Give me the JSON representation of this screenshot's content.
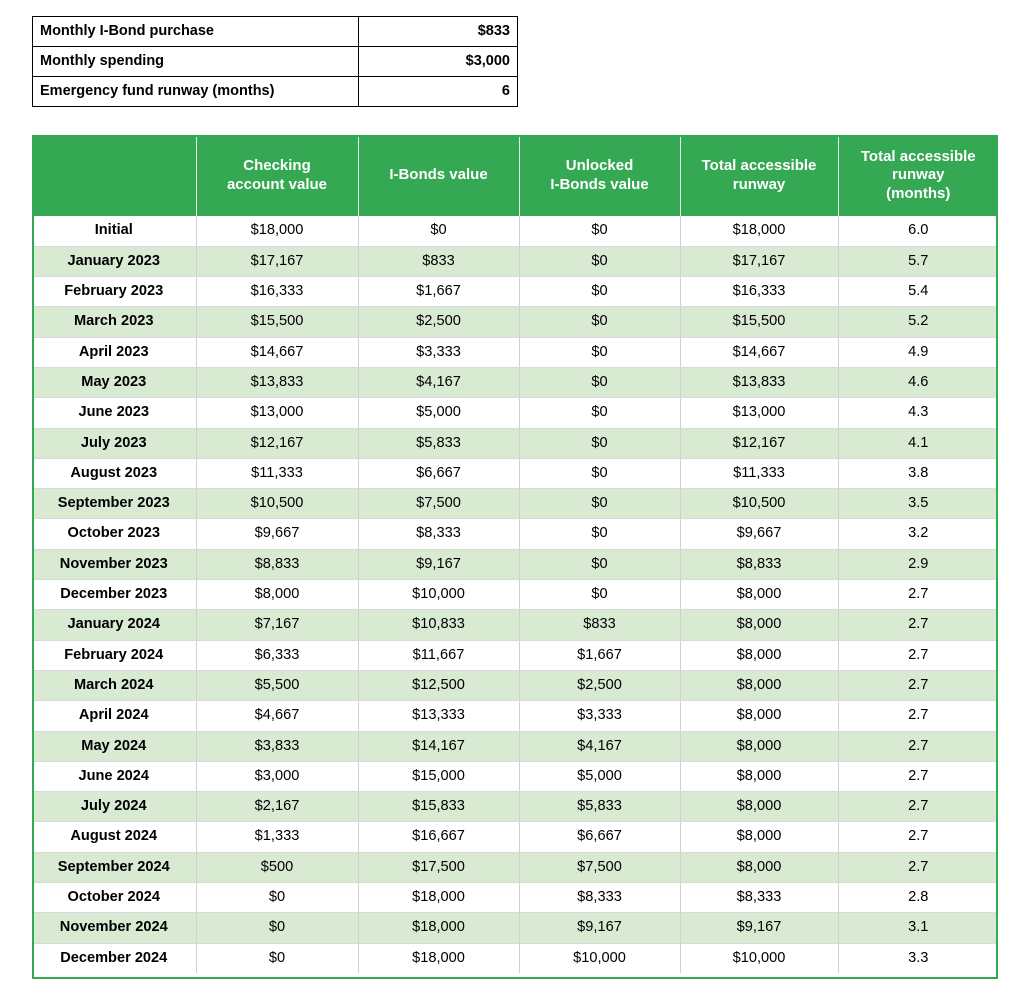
{
  "assumptions": {
    "rows": [
      {
        "label": "Monthly I-Bond purchase",
        "value": "$833"
      },
      {
        "label": "Monthly spending",
        "value": "$3,000"
      },
      {
        "label": "Emergency fund runway (months)",
        "value": "6"
      }
    ]
  },
  "runway": {
    "headers": [
      "",
      "Checking\naccount value",
      "I-Bonds value",
      "Unlocked\nI-Bonds value",
      "Total accessible\nrunway",
      "Total accessible\nrunway\n(months)"
    ],
    "rows": [
      {
        "month": "Initial",
        "checking": "$18,000",
        "ibonds": "$0",
        "unlocked": "$0",
        "total": "$18,000",
        "months": "6.0"
      },
      {
        "month": "January 2023",
        "checking": "$17,167",
        "ibonds": "$833",
        "unlocked": "$0",
        "total": "$17,167",
        "months": "5.7"
      },
      {
        "month": "February 2023",
        "checking": "$16,333",
        "ibonds": "$1,667",
        "unlocked": "$0",
        "total": "$16,333",
        "months": "5.4"
      },
      {
        "month": "March 2023",
        "checking": "$15,500",
        "ibonds": "$2,500",
        "unlocked": "$0",
        "total": "$15,500",
        "months": "5.2"
      },
      {
        "month": "April 2023",
        "checking": "$14,667",
        "ibonds": "$3,333",
        "unlocked": "$0",
        "total": "$14,667",
        "months": "4.9"
      },
      {
        "month": "May 2023",
        "checking": "$13,833",
        "ibonds": "$4,167",
        "unlocked": "$0",
        "total": "$13,833",
        "months": "4.6"
      },
      {
        "month": "June 2023",
        "checking": "$13,000",
        "ibonds": "$5,000",
        "unlocked": "$0",
        "total": "$13,000",
        "months": "4.3"
      },
      {
        "month": "July 2023",
        "checking": "$12,167",
        "ibonds": "$5,833",
        "unlocked": "$0",
        "total": "$12,167",
        "months": "4.1"
      },
      {
        "month": "August 2023",
        "checking": "$11,333",
        "ibonds": "$6,667",
        "unlocked": "$0",
        "total": "$11,333",
        "months": "3.8"
      },
      {
        "month": "September 2023",
        "checking": "$10,500",
        "ibonds": "$7,500",
        "unlocked": "$0",
        "total": "$10,500",
        "months": "3.5"
      },
      {
        "month": "October 2023",
        "checking": "$9,667",
        "ibonds": "$8,333",
        "unlocked": "$0",
        "total": "$9,667",
        "months": "3.2"
      },
      {
        "month": "November 2023",
        "checking": "$8,833",
        "ibonds": "$9,167",
        "unlocked": "$0",
        "total": "$8,833",
        "months": "2.9"
      },
      {
        "month": "December 2023",
        "checking": "$8,000",
        "ibonds": "$10,000",
        "unlocked": "$0",
        "total": "$8,000",
        "months": "2.7"
      },
      {
        "month": "January 2024",
        "checking": "$7,167",
        "ibonds": "$10,833",
        "unlocked": "$833",
        "total": "$8,000",
        "months": "2.7"
      },
      {
        "month": "February 2024",
        "checking": "$6,333",
        "ibonds": "$11,667",
        "unlocked": "$1,667",
        "total": "$8,000",
        "months": "2.7"
      },
      {
        "month": "March 2024",
        "checking": "$5,500",
        "ibonds": "$12,500",
        "unlocked": "$2,500",
        "total": "$8,000",
        "months": "2.7"
      },
      {
        "month": "April 2024",
        "checking": "$4,667",
        "ibonds": "$13,333",
        "unlocked": "$3,333",
        "total": "$8,000",
        "months": "2.7"
      },
      {
        "month": "May 2024",
        "checking": "$3,833",
        "ibonds": "$14,167",
        "unlocked": "$4,167",
        "total": "$8,000",
        "months": "2.7"
      },
      {
        "month": "June 2024",
        "checking": "$3,000",
        "ibonds": "$15,000",
        "unlocked": "$5,000",
        "total": "$8,000",
        "months": "2.7"
      },
      {
        "month": "July 2024",
        "checking": "$2,167",
        "ibonds": "$15,833",
        "unlocked": "$5,833",
        "total": "$8,000",
        "months": "2.7"
      },
      {
        "month": "August 2024",
        "checking": "$1,333",
        "ibonds": "$16,667",
        "unlocked": "$6,667",
        "total": "$8,000",
        "months": "2.7"
      },
      {
        "month": "September 2024",
        "checking": "$500",
        "ibonds": "$17,500",
        "unlocked": "$7,500",
        "total": "$8,000",
        "months": "2.7"
      },
      {
        "month": "October 2024",
        "checking": "$0",
        "ibonds": "$18,000",
        "unlocked": "$8,333",
        "total": "$8,333",
        "months": "2.8"
      },
      {
        "month": "November 2024",
        "checking": "$0",
        "ibonds": "$18,000",
        "unlocked": "$9,167",
        "total": "$9,167",
        "months": "3.1"
      },
      {
        "month": "December 2024",
        "checking": "$0",
        "ibonds": "$18,000",
        "unlocked": "$10,000",
        "total": "$10,000",
        "months": "3.3"
      }
    ]
  },
  "colors": {
    "header_green": "#34a853",
    "row_alt_green": "#d9ead3",
    "grid_gray": "#d0d0d0",
    "frame_black": "#000000"
  }
}
